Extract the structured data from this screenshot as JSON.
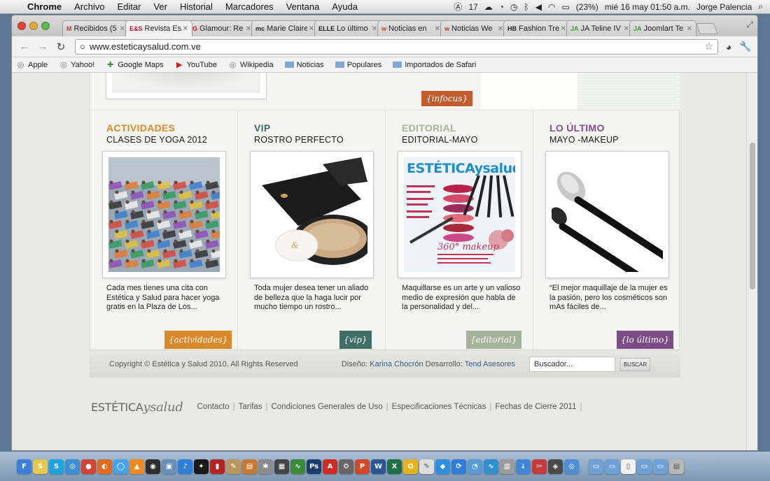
{
  "menubar": {
    "app": "Chrome",
    "items": [
      "Archivo",
      "Editar",
      "Ver",
      "Historial",
      "Marcadores",
      "Ventana",
      "Ayuda"
    ],
    "badge_count": "17",
    "battery": "(23%)",
    "clock": "mié 16 may  01:50 a.m.",
    "user": "Jorge Palencia"
  },
  "tabs": [
    {
      "favicon": "M",
      "label": "Recibidos (5",
      "color": "#c23b2b"
    },
    {
      "favicon": "E&S",
      "label": "Revista Esté",
      "color": "#c0122c",
      "active": true
    },
    {
      "favicon": "G",
      "label": "Glamour: Re",
      "color": "#c0122c"
    },
    {
      "favicon": "mc",
      "label": "Marie Claire",
      "color": "#222222"
    },
    {
      "favicon": "ELLE",
      "label": "Lo último e",
      "color": "#222222"
    },
    {
      "favicon": "w",
      "label": "Noticias en",
      "color": "#d33b1f"
    },
    {
      "favicon": "w",
      "label": "Noticias We",
      "color": "#d33b1f"
    },
    {
      "favicon": "HB",
      "label": "Fashion Tre",
      "color": "#222222"
    },
    {
      "favicon": "JA",
      "label": "JA Teline IV",
      "color": "#4c8f3c"
    },
    {
      "favicon": "JA",
      "label": "Joomlart Te",
      "color": "#4c8f3c"
    }
  ],
  "toolbar": {
    "url": "www.esteticaysalud.com.ve"
  },
  "bookmarks": [
    {
      "label": "Apple",
      "icon": "globe-icon"
    },
    {
      "label": "Yahoo!",
      "icon": "globe-icon"
    },
    {
      "label": "Google Maps",
      "icon": "maps-icon"
    },
    {
      "label": "YouTube",
      "icon": "youtube-icon"
    },
    {
      "label": "Wikipedia",
      "icon": "globe-icon"
    },
    {
      "label": "Noticias",
      "icon": "folder-icon"
    },
    {
      "label": "Populares",
      "icon": "folder-icon"
    },
    {
      "label": "Importados de Safari",
      "icon": "folder-icon"
    }
  ],
  "page": {
    "infocus_tag": "{infocus}",
    "columns": [
      {
        "category": "ACTIVIDADES",
        "category_color": "#d98a2a",
        "subtitle": "CLASES DE YOGA 2012",
        "description": "Cada mes tienes una cita con Estética y Salud para hacer yoga gratis en la Plaza de Los...",
        "tag": "{actividades}",
        "tag_color": "#d9892a"
      },
      {
        "category": "VIP",
        "category_color": "#3c6b63",
        "subtitle": "ROSTRO PERFECTO",
        "description": "Toda mujer desea tener un aliado de belleza que la haga lucir por mucho tiempo un rostro...",
        "tag": "{vip}",
        "tag_color": "#3f6e62"
      },
      {
        "category": "EDITORIAL",
        "category_color": "#a8b39a",
        "subtitle": "EDITORIAL-MAYO",
        "description": "Maquillarse es un arte y un valioso medio de expresión que habla de la personalidad y del...",
        "tag": "{editorial}",
        "tag_color": "#a6b39b"
      },
      {
        "category": "LO ÚLTIMO",
        "category_color": "#7e4f88",
        "subtitle": "MAYO -MAKEUP",
        "description": "“El mejor maquillaje de la mujer es la pasión, pero los cosméticos son mAs fáciles de...",
        "tag": "{lo último}",
        "tag_color": "#7b4c86"
      }
    ],
    "magazine": {
      "title": "ESTÉTICAysalud",
      "cover_line": "360° makeup"
    },
    "copyright": "Copyright © Estética y Salud 2010. All Rights Reserved",
    "design_label": "Diseño:",
    "designer": "Karina Chocrón",
    "dev_label": "Desarrollo:",
    "developer": "Tend Asesores",
    "search_placeholder": "Buscador...",
    "search_button": "BUSCAR",
    "footer_logo_a": "ESTÉTICA",
    "footer_logo_b": "ysalud",
    "footer_links": [
      "Contacto",
      "Tarifas",
      "Condiciones Generales de Uso",
      "Especificaciones Técnicas",
      "Fechas de Cierre 2011"
    ]
  },
  "dock": [
    {
      "name": "finder",
      "color": "#3d7fd6",
      "glyph": "F"
    },
    {
      "name": "stickies",
      "color": "#e8c84a",
      "glyph": "S"
    },
    {
      "name": "skype",
      "color": "#1ea3e0",
      "glyph": "S"
    },
    {
      "name": "safari",
      "color": "#3b8fd9",
      "glyph": "◎"
    },
    {
      "name": "chrome",
      "color": "#d14436",
      "glyph": "●"
    },
    {
      "name": "firefox",
      "color": "#e26a1d",
      "glyph": "◐"
    },
    {
      "name": "ichat",
      "color": "#4aa3e6",
      "glyph": "◯"
    },
    {
      "name": "vlc",
      "color": "#f08a1c",
      "glyph": "▲"
    },
    {
      "name": "dashboard",
      "color": "#2e2e2e",
      "glyph": "◉"
    },
    {
      "name": "iphoto",
      "color": "#6a8fb5",
      "glyph": "▣"
    },
    {
      "name": "itunes",
      "color": "#2f7fd9",
      "glyph": "♪"
    },
    {
      "name": "blackberry",
      "color": "#1a1a1a",
      "glyph": "✦"
    },
    {
      "name": "photobooth",
      "color": "#b32525",
      "glyph": "▮"
    },
    {
      "name": "script-editor",
      "color": "#b9985c",
      "glyph": "✎"
    },
    {
      "name": "preview",
      "color": "#c87933",
      "glyph": "▤"
    },
    {
      "name": "tool",
      "color": "#8c8c8c",
      "glyph": "✱"
    },
    {
      "name": "monitor",
      "color": "#444444",
      "glyph": "▦"
    },
    {
      "name": "activity",
      "color": "#3a8a3a",
      "glyph": "∿"
    },
    {
      "name": "photoshop",
      "color": "#1a3d6d",
      "glyph": "Ps"
    },
    {
      "name": "acrobat",
      "color": "#d42a20",
      "glyph": "A"
    },
    {
      "name": "tool2",
      "color": "#666666",
      "glyph": "⚙"
    },
    {
      "name": "powerpoint",
      "color": "#d24726",
      "glyph": "P"
    },
    {
      "name": "word",
      "color": "#2b5797",
      "glyph": "W"
    },
    {
      "name": "excel",
      "color": "#1e7145",
      "glyph": "X"
    },
    {
      "name": "outlook",
      "color": "#e8b21c",
      "glyph": "O"
    },
    {
      "name": "textedit",
      "color": "#dddddd",
      "glyph": "✎"
    },
    {
      "name": "dropbox",
      "color": "#2f8ee0",
      "glyph": "◆"
    },
    {
      "name": "sync",
      "color": "#2e7dd6",
      "glyph": "⟳"
    },
    {
      "name": "time",
      "color": "#5b9bd5",
      "glyph": "◔"
    },
    {
      "name": "dreamweaver",
      "color": "#2f8fcf",
      "glyph": "∿"
    },
    {
      "name": "trash-like",
      "color": "#9a9a9a",
      "glyph": "▥"
    },
    {
      "name": "downloads",
      "color": "#3f86d9",
      "glyph": "↓"
    },
    {
      "name": "tool3",
      "color": "#c33b3b",
      "glyph": "✂"
    },
    {
      "name": "tool4",
      "color": "#4a4a4a",
      "glyph": "◈"
    },
    {
      "name": "network",
      "color": "#4e8fd4",
      "glyph": "◎"
    },
    {
      "name": "folder1",
      "color": "#6fa0d6",
      "glyph": "▭"
    },
    {
      "name": "folder2",
      "color": "#6fa0d6",
      "glyph": "▭"
    },
    {
      "name": "document",
      "color": "#f1f1f1",
      "glyph": "▯"
    },
    {
      "name": "folder3",
      "color": "#6fa0d6",
      "glyph": "▭"
    },
    {
      "name": "folder4",
      "color": "#6fa0d6",
      "glyph": "▭"
    },
    {
      "name": "trash",
      "color": "#b8b8b8",
      "glyph": "▤"
    }
  ]
}
